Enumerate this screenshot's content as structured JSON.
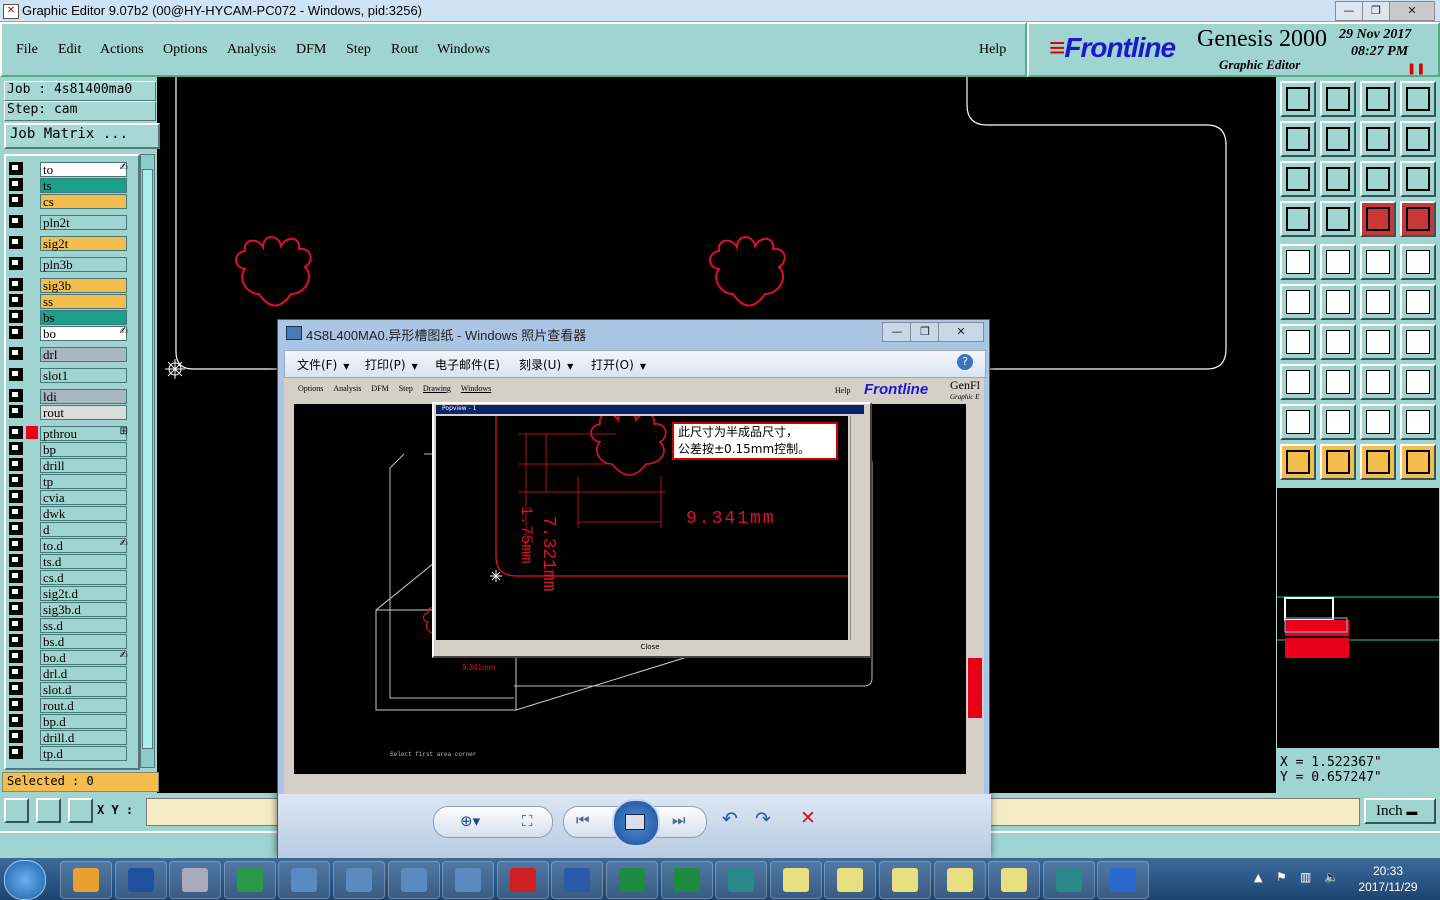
{
  "window": {
    "title": "Graphic Editor 9.07b2 (00@HY-HYCAM-PC072 - Windows, pid:3256)",
    "controls": [
      "—",
      "❐",
      "✕"
    ]
  },
  "menu": {
    "items": [
      "File",
      "Edit",
      "Actions",
      "Options",
      "Analysis",
      "DFM",
      "Step",
      "Rout",
      "Windows"
    ],
    "help": "Help"
  },
  "brand": {
    "logo": "Frontline",
    "product": "Genesis 2000",
    "subtitle": "Graphic Editor",
    "date": "29 Nov 2017",
    "time": "08:27 PM"
  },
  "left": {
    "job": "Job : 4s81400ma0",
    "step": "Step: cam",
    "job_matrix": "Job Matrix ...",
    "selected": "Selected : 0",
    "layers": [
      {
        "name": "to",
        "color": "#ffffff",
        "mark": "✍"
      },
      {
        "name": "ts",
        "color": "#1aa08a"
      },
      {
        "name": "cs",
        "color": "#f5bd4d"
      },
      {
        "name": "pln2t",
        "color": "#9fd4d0"
      },
      {
        "name": "sig2t",
        "color": "#f5bd4d"
      },
      {
        "name": "pln3b",
        "color": "#9fd4d0"
      },
      {
        "name": "sig3b",
        "color": "#f5bd4d"
      },
      {
        "name": "ss",
        "color": "#f5bd4d"
      },
      {
        "name": "bs",
        "color": "#1aa08a"
      },
      {
        "name": "bo",
        "color": "#ffffff",
        "mark": "✍"
      },
      {
        "name": "drl",
        "color": "#a8b8c0"
      },
      {
        "name": "slot1",
        "color": "#9fd4d0"
      },
      {
        "name": "ldi",
        "color": "#a8b8c0"
      },
      {
        "name": "rout",
        "color": "#d8dcdc"
      },
      {
        "name": "pthrou",
        "color": "#9fd4d0",
        "mark": "⊞"
      },
      {
        "name": "bp",
        "color": "#9fd4d0"
      },
      {
        "name": "drill",
        "color": "#9fd4d0"
      },
      {
        "name": "tp",
        "color": "#9fd4d0"
      },
      {
        "name": "cvia",
        "color": "#9fd4d0"
      },
      {
        "name": "dwk",
        "color": "#9fd4d0"
      },
      {
        "name": "d",
        "color": "#9fd4d0"
      },
      {
        "name": "to.d",
        "color": "#9fd4d0",
        "mark": "✍"
      },
      {
        "name": "ts.d",
        "color": "#9fd4d0"
      },
      {
        "name": "cs.d",
        "color": "#9fd4d0"
      },
      {
        "name": "sig2t.d",
        "color": "#9fd4d0"
      },
      {
        "name": "sig3b.d",
        "color": "#9fd4d0"
      },
      {
        "name": "ss.d",
        "color": "#9fd4d0"
      },
      {
        "name": "bs.d",
        "color": "#9fd4d0"
      },
      {
        "name": "bo.d",
        "color": "#9fd4d0",
        "mark": "✍"
      },
      {
        "name": "drl.d",
        "color": "#9fd4d0"
      },
      {
        "name": "slot.d",
        "color": "#9fd4d0"
      },
      {
        "name": "rout.d",
        "color": "#9fd4d0"
      },
      {
        "name": "bp.d",
        "color": "#9fd4d0"
      },
      {
        "name": "drill.d",
        "color": "#9fd4d0"
      },
      {
        "name": "tp.d",
        "color": "#9fd4d0"
      }
    ]
  },
  "coords": {
    "x": "X = 1.522367\"",
    "y": "Y = 0.657247\""
  },
  "bottom": {
    "xy_label": "X Y :",
    "xy_value": "",
    "unit": "Inch"
  },
  "viewer": {
    "title": "4S8L400MA0.异形槽图纸 - Windows 照片查看器",
    "menu": [
      "文件(F)",
      "打印(P)",
      "电子邮件(E)",
      "刻录(U)",
      "打开(O)"
    ],
    "note_line1": "此尺寸为半成品尺寸，",
    "note_line2": "公差按±0.15mm控制。",
    "dim_horizontal": "9.341mm",
    "dim_vertical1": "7.321mm",
    "dim_vertical2": "1.75mm",
    "inner_menu": [
      "Options",
      "Analysis",
      "DFM",
      "Step",
      "Drawing",
      "Windows"
    ],
    "inner_help": "Help",
    "inner_logo": "Frontline",
    "inner_product": "GenFl",
    "inner_sub": "Graphic E",
    "popup_title": "Popview - 1",
    "popup_close": "Close",
    "inner_status": "Select first area corner",
    "thumb_dim": "9.341mm"
  },
  "taskbar": {
    "time": "20:33",
    "date": "2017/11/29"
  }
}
